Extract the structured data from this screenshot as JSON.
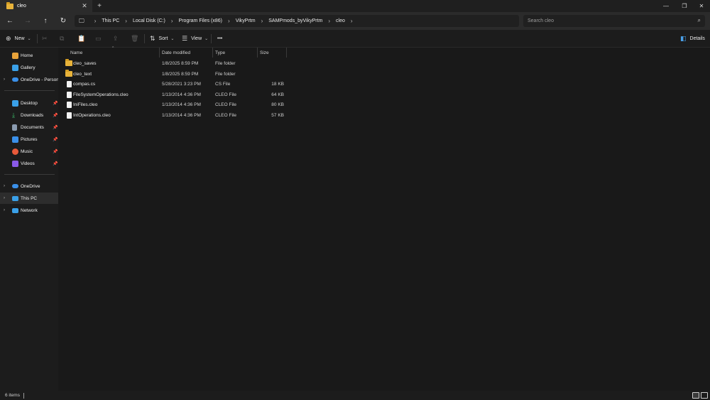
{
  "tab": {
    "title": "cleo",
    "close": "✕",
    "new": "+"
  },
  "window_controls": {
    "minimize": "—",
    "maximize": "❐",
    "close": "✕"
  },
  "nav": {
    "back": "←",
    "forward": "→",
    "up": "↑",
    "refresh": "↻"
  },
  "breadcrumbs": [
    "This PC",
    "Local Disk (C:)",
    "Program Files (x86)",
    "VikyPrtm",
    "SAMPmods_byVikyPrtm",
    "cleo"
  ],
  "search": {
    "placeholder": "Search cleo"
  },
  "commands": {
    "new": "New",
    "sort": "Sort",
    "view": "View",
    "more": "•••",
    "details": "Details"
  },
  "sidebar": {
    "items": [
      {
        "label": "Home",
        "icon": "home-icon",
        "color": "#e8a33a"
      },
      {
        "label": "Gallery",
        "icon": "gallery-icon",
        "color": "#3aa0e8"
      },
      {
        "label": "OneDrive - Personal",
        "icon": "onedrive-icon",
        "color": "#3a8fe8"
      },
      {
        "label": "Desktop",
        "icon": "desktop-icon",
        "color": "#3aa0e8"
      },
      {
        "label": "Downloads",
        "icon": "downloads-icon",
        "color": "#3ac06a"
      },
      {
        "label": "Documents",
        "icon": "documents-icon",
        "color": "#8a9bb0"
      },
      {
        "label": "Pictures",
        "icon": "pictures-icon",
        "color": "#3a8fe8"
      },
      {
        "label": "Music",
        "icon": "music-icon",
        "color": "#e85a3a"
      },
      {
        "label": "Videos",
        "icon": "videos-icon",
        "color": "#8a5ae8"
      },
      {
        "label": "OneDrive",
        "icon": "onedrive-icon",
        "color": "#3a8fe8"
      },
      {
        "label": "This PC",
        "icon": "pc-icon",
        "color": "#3aa0e8"
      },
      {
        "label": "Network",
        "icon": "network-icon",
        "color": "#3aa0e8"
      }
    ]
  },
  "columns": {
    "name": "Name",
    "date": "Date modified",
    "type": "Type",
    "size": "Size"
  },
  "files": [
    {
      "name": "cleo_saves",
      "date": "1/8/2025 8:59 PM",
      "type": "File folder",
      "size": "",
      "kind": "folder"
    },
    {
      "name": "cleo_text",
      "date": "1/8/2025 8:59 PM",
      "type": "File folder",
      "size": "",
      "kind": "folder"
    },
    {
      "name": "compas.cs",
      "date": "5/28/2021 3:23 PM",
      "type": "CS File",
      "size": "18 KB",
      "kind": "file"
    },
    {
      "name": "FileSystemOperations.cleo",
      "date": "1/13/2014 4:36 PM",
      "type": "CLEO File",
      "size": "64 KB",
      "kind": "file"
    },
    {
      "name": "IniFiles.cleo",
      "date": "1/13/2014 4:36 PM",
      "type": "CLEO File",
      "size": "80 KB",
      "kind": "file"
    },
    {
      "name": "IntOperations.cleo",
      "date": "1/13/2014 4:36 PM",
      "type": "CLEO File",
      "size": "57 KB",
      "kind": "file"
    }
  ],
  "status": {
    "count": "6 items"
  },
  "colors": {
    "background": "#191919",
    "folder": "#e8b33a",
    "selected": "#2d2d2d"
  }
}
